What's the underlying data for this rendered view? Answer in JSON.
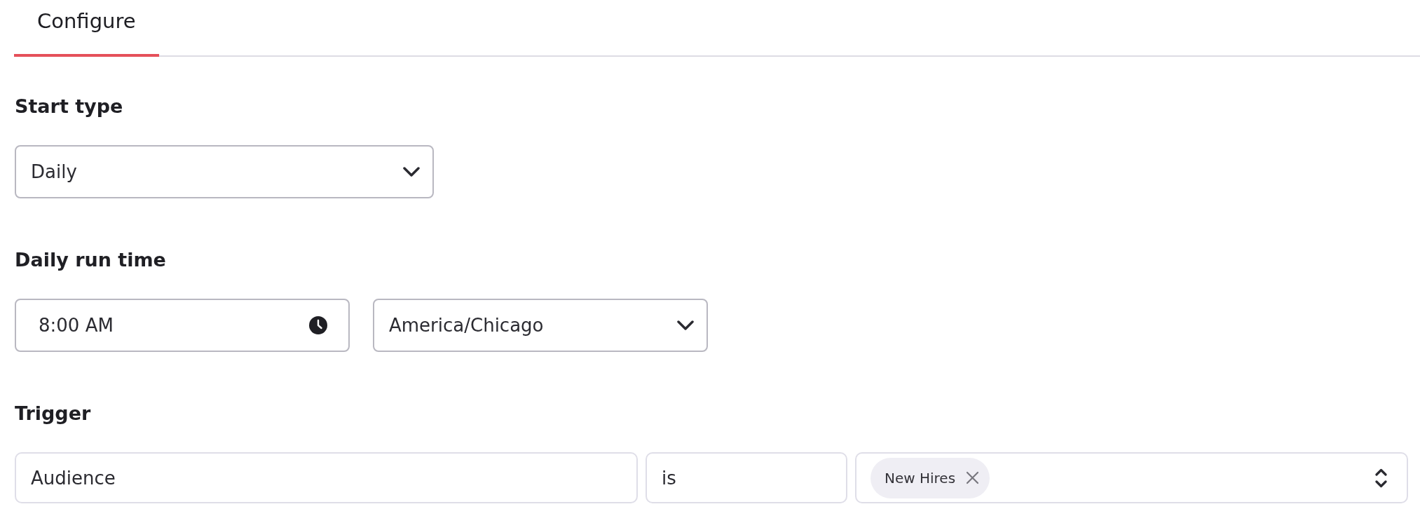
{
  "tabs": [
    {
      "label": "Configure",
      "selected": true
    }
  ],
  "sections": [
    {
      "label": "Start type",
      "fields": [
        {
          "kind": "select",
          "value": "Daily"
        }
      ]
    },
    {
      "label": "Daily run time",
      "fields": [
        {
          "kind": "time",
          "value": "8:00 AM"
        },
        {
          "kind": "select",
          "value": "America/Chicago"
        }
      ]
    },
    {
      "label": "Trigger",
      "fields": [
        {
          "kind": "text",
          "value": "Audience"
        },
        {
          "kind": "text",
          "value": "is"
        },
        {
          "kind": "multiselect",
          "tags": [
            "New Hires"
          ]
        }
      ]
    }
  ]
}
